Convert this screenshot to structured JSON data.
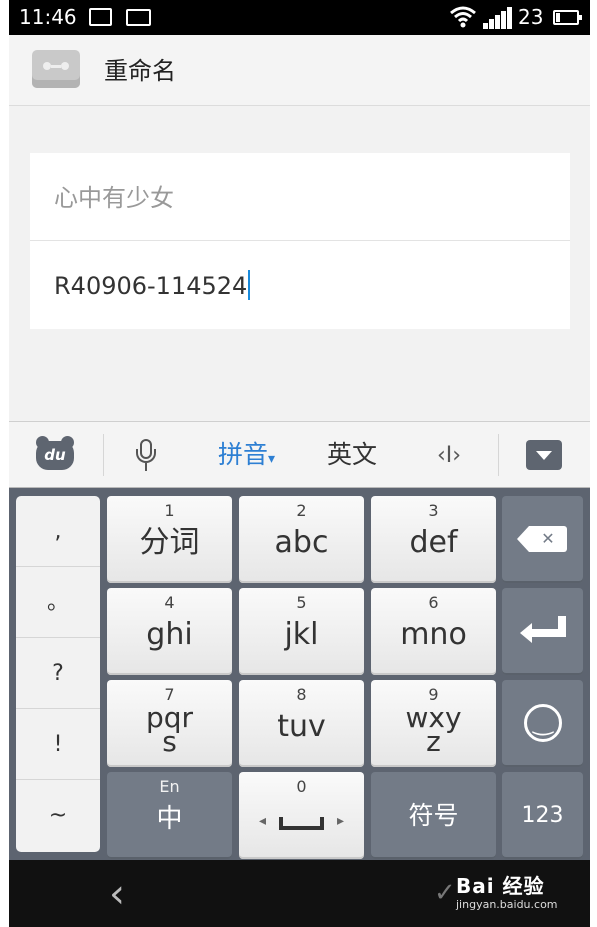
{
  "status_bar": {
    "time": "11:46",
    "battery": "23",
    "icons": [
      "image-icon",
      "keyboard-icon",
      "wifi-icon",
      "signal-icon",
      "battery-icon"
    ]
  },
  "title_bar": {
    "title": "重命名",
    "icon": "recorder-icon"
  },
  "fields": [
    {
      "value": "心中有少女"
    },
    {
      "value": "R40906-114524"
    }
  ],
  "keyboard_toolbar": {
    "pinyin_label": "拼音",
    "english_label": "英文",
    "cursor_label": "‹I›",
    "du_label": "du"
  },
  "keyboard": {
    "side_column": [
      ",",
      "。",
      "?",
      "!",
      "~"
    ],
    "keys": [
      {
        "num": "1",
        "letters": "分词"
      },
      {
        "num": "2",
        "letters": "abc"
      },
      {
        "num": "3",
        "letters": "def"
      },
      {
        "num": "4",
        "letters": "ghi"
      },
      {
        "num": "5",
        "letters": "jkl"
      },
      {
        "num": "6",
        "letters": "mno"
      },
      {
        "num": "7",
        "letters": "pqr\ns"
      },
      {
        "num": "8",
        "letters": "tuv"
      },
      {
        "num": "9",
        "letters": "wxy\nz"
      }
    ],
    "bottom_row": {
      "lang_top": "En",
      "lang_main": "中",
      "space_num": "0",
      "symbols": "符号",
      "numeric": "123"
    }
  },
  "nav": {
    "back": "‹",
    "watermark_main": "Bai 经验",
    "watermark_sub": "jingyan.baidu.com"
  },
  "colors": {
    "accent": "#2d7fd3",
    "caret": "#1a8bdc",
    "keyboard_bg": "#5d6470",
    "function_key": "#737b87"
  }
}
